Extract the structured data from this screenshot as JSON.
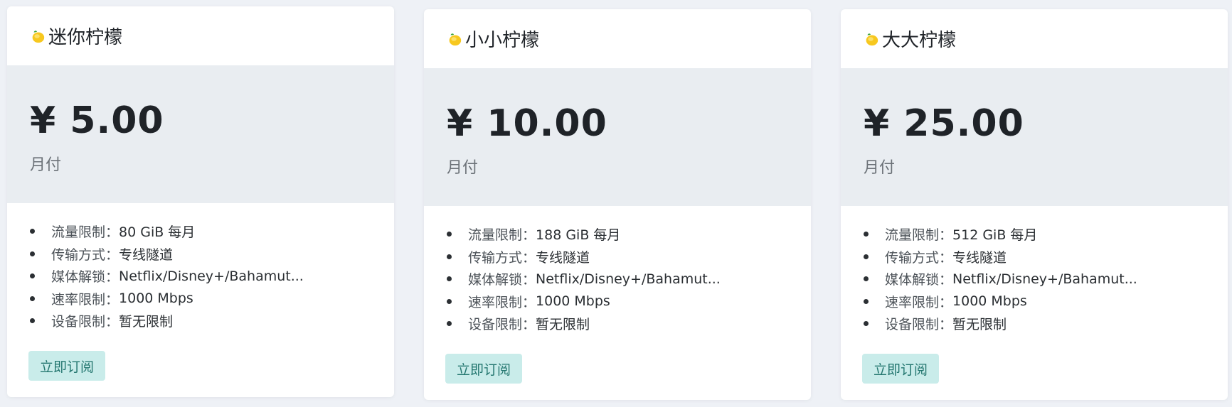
{
  "plans": [
    {
      "title": "迷你柠檬",
      "price": "¥ 5.00",
      "period": "月付",
      "features": [
        {
          "label": "流量限制：",
          "value": "80 GiB 每月"
        },
        {
          "label": "传输方式：",
          "value": "专线隧道"
        },
        {
          "label": "媒体解锁：",
          "value": "Netflix/Disney+/Bahamut..."
        },
        {
          "label": "速率限制：",
          "value": "1000 Mbps"
        },
        {
          "label": "设备限制：",
          "value": "暂无限制"
        }
      ],
      "button": "立即订阅"
    },
    {
      "title": "小小柠檬",
      "price": "¥ 10.00",
      "period": "月付",
      "features": [
        {
          "label": "流量限制：",
          "value": "188 GiB 每月"
        },
        {
          "label": "传输方式：",
          "value": "专线隧道"
        },
        {
          "label": "媒体解锁：",
          "value": "Netflix/Disney+/Bahamut..."
        },
        {
          "label": "速率限制：",
          "value": "1000 Mbps"
        },
        {
          "label": "设备限制：",
          "value": "暂无限制"
        }
      ],
      "button": "立即订阅"
    },
    {
      "title": "大大柠檬",
      "price": "¥ 25.00",
      "period": "月付",
      "features": [
        {
          "label": "流量限制：",
          "value": "512 GiB 每月"
        },
        {
          "label": "传输方式：",
          "value": "专线隧道"
        },
        {
          "label": "媒体解锁：",
          "value": "Netflix/Disney+/Bahamut..."
        },
        {
          "label": "速率限制：",
          "value": "1000 Mbps"
        },
        {
          "label": "设备限制：",
          "value": "暂无限制"
        }
      ],
      "button": "立即订阅"
    }
  ],
  "icons": {
    "title_icon": "lemon-icon"
  },
  "colors": {
    "page_bg": "#eef1f6",
    "price_band": "#e9edf1",
    "button_bg": "#c9ecea",
    "button_text": "#23766f"
  }
}
